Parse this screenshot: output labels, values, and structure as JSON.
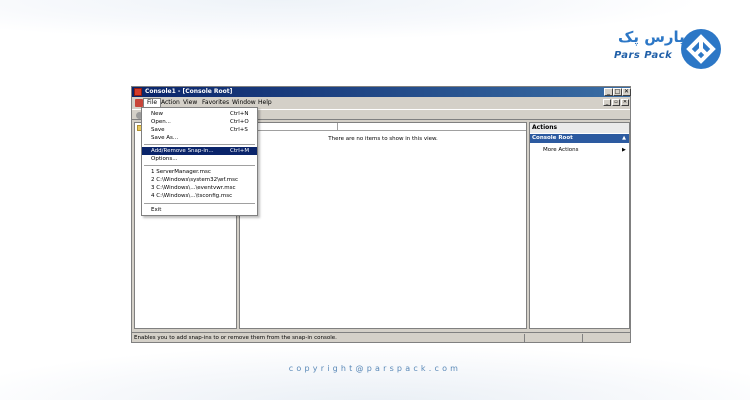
{
  "brand": {
    "name_fa": "پارس پک",
    "name_en": "Pars Pack",
    "copyright": "copyright@parspack.com",
    "color": "#2c77c6"
  },
  "window": {
    "title": "Console1 - [Console Root]",
    "controls": [
      "_",
      "□",
      "✕"
    ],
    "title_color": "#0a246a"
  },
  "menubar": {
    "items": [
      "File",
      "Action",
      "View",
      "Favorites",
      "Window",
      "Help"
    ],
    "mdi_controls": [
      "_",
      "▫",
      "✕"
    ]
  },
  "file_menu": {
    "items": [
      {
        "label": "New",
        "shortcut": "Ctrl+N"
      },
      {
        "label": "Open...",
        "shortcut": "Ctrl+O"
      },
      {
        "label": "Save",
        "shortcut": "Ctrl+S"
      },
      {
        "label": "Save As...",
        "shortcut": ""
      },
      {
        "label": "Add/Remove Snap-in...",
        "shortcut": "Ctrl+M",
        "highlighted": true
      },
      {
        "label": "Options...",
        "shortcut": ""
      },
      {
        "label": "1 ServerManager.msc",
        "shortcut": ""
      },
      {
        "label": "2 C:\\Windows\\system32\\wf.msc",
        "shortcut": ""
      },
      {
        "label": "3 C:\\Windows\\...\\eventvwr.msc",
        "shortcut": ""
      },
      {
        "label": "4 C:\\Windows\\...\\tsconfig.msc",
        "shortcut": ""
      },
      {
        "label": "Exit",
        "shortcut": ""
      }
    ],
    "highlight_color": "#0a246a"
  },
  "center": {
    "empty_message": "There are no items to show in this view."
  },
  "actions": {
    "title": "Actions",
    "section": "Console Root",
    "more": "More Actions",
    "collapse_icon": "▲",
    "more_icon": "▶",
    "section_color": "#2c5aa0"
  },
  "status": {
    "text": "Enables you to add snap-ins to or remove them from the snap-in console."
  }
}
